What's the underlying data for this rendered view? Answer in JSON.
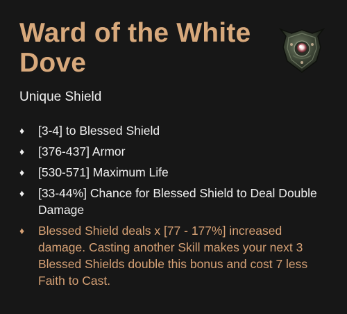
{
  "item": {
    "name": "Ward of the White Dove",
    "type": "Unique Shield",
    "icon": "shield-icon",
    "affixes": [
      {
        "text": "[3-4] to Blessed Shield"
      },
      {
        "text": "[376-437] Armor"
      },
      {
        "text": "[530-571] Maximum Life"
      },
      {
        "text": "[33-44%] Chance for Blessed Shield to Deal Double Damage"
      }
    ],
    "unique_power": "Blessed Shield deals x [77 - 177%] increased damage. Casting another Skill makes your next 3 Blessed Shields double this bonus and cost 7 less Faith to Cast.",
    "bullet": "♦"
  },
  "colors": {
    "background": "#171717",
    "title": "#d8a97c",
    "text": "#f0f0f0",
    "unique_power": "#d6a175"
  }
}
